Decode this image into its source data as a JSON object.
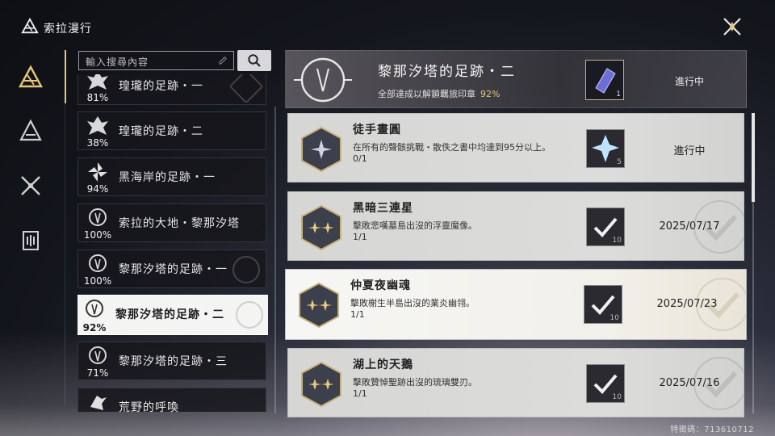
{
  "app": {
    "title": "索拉漫行"
  },
  "search": {
    "placeholder": "輸入搜尋內容"
  },
  "rail": [
    "solaris-icon",
    "tower-icon",
    "crossed-swords-icon",
    "archive-icon"
  ],
  "list": [
    {
      "name": "瑝瓏的足跡・一",
      "percent": "81%"
    },
    {
      "name": "瑝瓏的足跡・二",
      "percent": "38%"
    },
    {
      "name": "黑海岸的足跡・一",
      "percent": "94%"
    },
    {
      "name": "索拉的大地・黎那汐塔",
      "percent": "100%"
    },
    {
      "name": "黎那汐塔的足跡・一",
      "percent": "100%"
    },
    {
      "name": "黎那汐塔的足跡・二",
      "percent": "92%",
      "active": true
    },
    {
      "name": "黎那汐塔的足跡・三",
      "percent": "71%"
    },
    {
      "name": "荒野的呼喚",
      "percent": ""
    }
  ],
  "header": {
    "title": "黎那汐塔的足跡・二",
    "subtitle": "全部達成以解鎖羈旅印章",
    "percent": "92%",
    "reward_count": "1",
    "status": "進行中"
  },
  "tasks": [
    {
      "title": "徒手畫圓",
      "desc": "在所有的聲骸挑戰・散佚之書中均達到95分以上。",
      "progress": "0/1",
      "reward_count": "5",
      "state": "進行中",
      "done": false,
      "icon": "star-single-icon",
      "bright": false
    },
    {
      "title": "黑暗三連星",
      "desc": "擊敗悲嘆墓島出沒的浮靈魔像。",
      "progress": "1/1",
      "reward_count": "10",
      "state": "2025/07/17",
      "done": true,
      "icon": "star-double-icon",
      "bright": false
    },
    {
      "title": "仲夏夜幽魂",
      "desc": "擊敗榭生半島出沒的業炎幽翎。",
      "progress": "1/1",
      "reward_count": "10",
      "state": "2025/07/23",
      "done": true,
      "icon": "star-double-icon",
      "bright": true
    },
    {
      "title": "湖上的天鵝",
      "desc": "擊敗贊悼聖跡出沒的琉璃雙刃。",
      "progress": "1/1",
      "reward_count": "10",
      "state": "2025/07/16",
      "done": true,
      "icon": "star-double-icon",
      "bright": false
    }
  ],
  "footer": {
    "uid": "特徵碼：713610712"
  },
  "colors": {
    "gold": "#e7c77a",
    "card": "#d8d8d6",
    "dark": "#14161d"
  }
}
